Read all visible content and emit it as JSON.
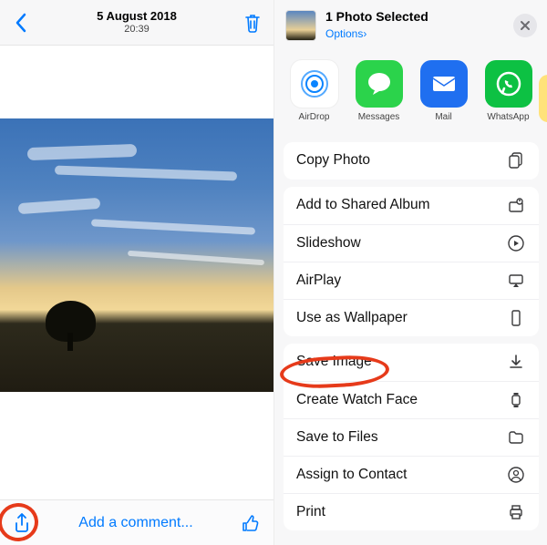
{
  "colors": {
    "tint": "#007aff",
    "annotation": "#e63a1a"
  },
  "left": {
    "header": {
      "date": "5 August 2018",
      "time": "20:39"
    },
    "comment_placeholder": "Add a comment..."
  },
  "sheet": {
    "dim_header": "5 August 2018",
    "title": "1 Photo Selected",
    "options_label": "Options",
    "chevron": "›",
    "apps": [
      {
        "id": "airdrop",
        "label": "AirDrop"
      },
      {
        "id": "messages",
        "label": "Messages"
      },
      {
        "id": "mail",
        "label": "Mail"
      },
      {
        "id": "whatsapp",
        "label": "WhatsApp"
      }
    ],
    "group1": [
      {
        "id": "copy",
        "label": "Copy Photo",
        "icon": "copy"
      }
    ],
    "group2": [
      {
        "id": "shared",
        "label": "Add to Shared Album",
        "icon": "album"
      },
      {
        "id": "slide",
        "label": "Slideshow",
        "icon": "play"
      },
      {
        "id": "airplay",
        "label": "AirPlay",
        "icon": "airplay"
      },
      {
        "id": "wall",
        "label": "Use as Wallpaper",
        "icon": "phone"
      }
    ],
    "group3": [
      {
        "id": "save",
        "label": "Save Image",
        "icon": "download"
      },
      {
        "id": "watch",
        "label": "Create Watch Face",
        "icon": "watch"
      },
      {
        "id": "files",
        "label": "Save to Files",
        "icon": "folder"
      },
      {
        "id": "contact",
        "label": "Assign to Contact",
        "icon": "person"
      },
      {
        "id": "print",
        "label": "Print",
        "icon": "printer"
      }
    ]
  }
}
